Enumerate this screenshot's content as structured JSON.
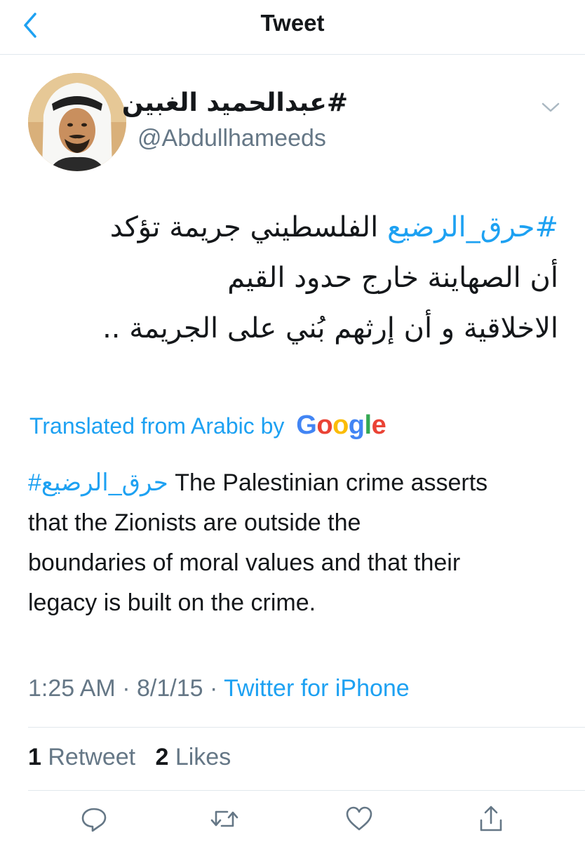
{
  "nav": {
    "back_icon": "chevron-left-icon",
    "title": "Tweet"
  },
  "author": {
    "display_name": "#عبدالحميد الغبين",
    "handle": "@Abdullhameeds",
    "avatar": "profile-photo"
  },
  "tweet": {
    "arabic": {
      "hashtag": "#حرق_الرضيع",
      "line1_rest": "الفلسطيني جريمة تؤكد",
      "line2": "أن الصهاينة خارج حدود القيم",
      "line3": "الاخلاقية و أن إرثهم بُني على الجريمة .."
    },
    "translation": {
      "label": "Translated from Arabic by",
      "provider": "Google",
      "hashtag": "#حرق_الرضيع",
      "line1_rest": " The Palestinian crime asserts",
      "line2": "that the Zionists are outside the",
      "line3": "boundaries of moral values and that their",
      "line4": "legacy is built on the crime."
    },
    "time": "1:25 AM",
    "date": "8/1/15",
    "separator": "·",
    "source": "Twitter for iPhone"
  },
  "stats": {
    "retweets_count": "1",
    "retweets_label": "Retweet",
    "likes_count": "2",
    "likes_label": "Likes"
  },
  "actions": {
    "reply_icon": "reply-icon",
    "retweet_icon": "retweet-icon",
    "like_icon": "heart-icon",
    "share_icon": "share-icon"
  },
  "colors": {
    "link": "#1da1f2",
    "text": "#14171a",
    "secondary": "#657786",
    "divider": "#e1e8ed",
    "google_blue": "#4285f4",
    "google_red": "#ea4335",
    "google_yellow": "#fbbc05",
    "google_green": "#34a853"
  }
}
